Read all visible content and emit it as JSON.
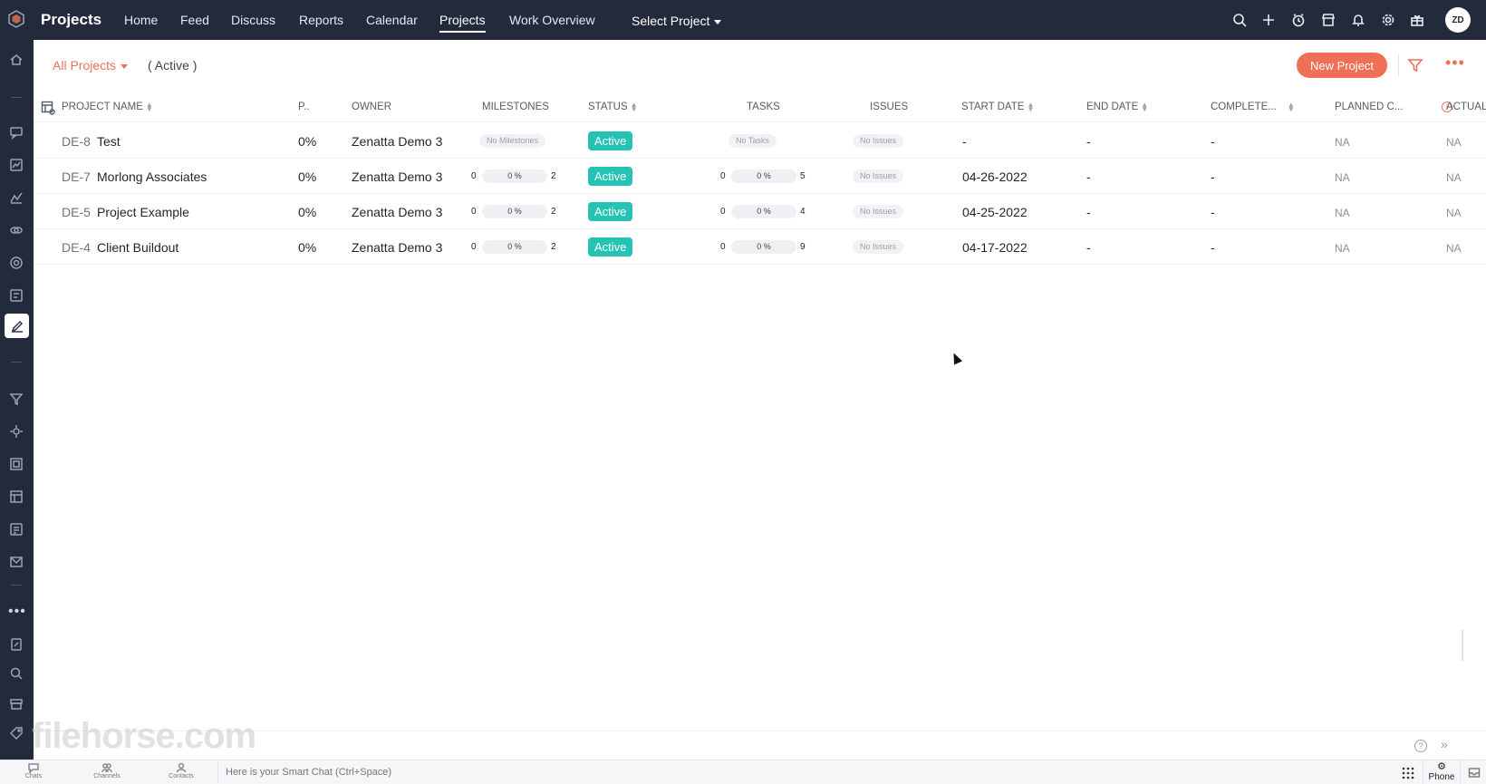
{
  "header": {
    "app_title": "Projects",
    "nav": [
      {
        "label": "Home"
      },
      {
        "label": "Feed"
      },
      {
        "label": "Discuss"
      },
      {
        "label": "Reports"
      },
      {
        "label": "Calendar"
      },
      {
        "label": "Projects",
        "active": true
      },
      {
        "label": "Work Overview"
      }
    ],
    "select_project": "Select Project",
    "icons": [
      "search-icon",
      "add-icon",
      "timer-icon",
      "store-icon",
      "bell-icon",
      "gear-icon",
      "gift-icon"
    ],
    "avatar_initials": "ZD"
  },
  "subheader": {
    "filter_label": "All Projects",
    "status_filter": "( Active )",
    "new_project_label": "New Project"
  },
  "table": {
    "columns": {
      "project_name": "PROJECT NAME",
      "percent": "P..",
      "owner": "OWNER",
      "milestones": "MILESTONES",
      "status": "STATUS",
      "tasks": "TASKS",
      "issues": "ISSUES",
      "start_date": "START DATE",
      "end_date": "END DATE",
      "completed": "COMPLETE...",
      "planned": "PLANNED C...",
      "actual": "ACTUAL"
    },
    "rows": [
      {
        "key": "DE-8",
        "name": "Test",
        "percent": "0%",
        "owner": "Zenatta Demo 3",
        "milestones_empty": "No Milestones",
        "status": "Active",
        "tasks_empty": "No Tasks",
        "issues": "No Issues",
        "start_date": "-",
        "end_date": "-",
        "completed": "-",
        "planned": "NA",
        "actual": "NA"
      },
      {
        "key": "DE-7",
        "name": "Morlong Associates",
        "percent": "0%",
        "owner": "Zenatta Demo 3",
        "milestones": {
          "done": "0",
          "pct": "0 %",
          "total": "2"
        },
        "status": "Active",
        "tasks": {
          "done": "0",
          "pct": "0 %",
          "total": "5"
        },
        "issues": "No Issues",
        "start_date": "04-26-2022",
        "end_date": "-",
        "completed": "-",
        "planned": "NA",
        "actual": "NA"
      },
      {
        "key": "DE-5",
        "name": "Project Example",
        "percent": "0%",
        "owner": "Zenatta Demo 3",
        "milestones": {
          "done": "0",
          "pct": "0 %",
          "total": "2"
        },
        "status": "Active",
        "tasks": {
          "done": "0",
          "pct": "0 %",
          "total": "4"
        },
        "issues": "No Issues",
        "start_date": "04-25-2022",
        "end_date": "-",
        "completed": "-",
        "planned": "NA",
        "actual": "NA"
      },
      {
        "key": "DE-4",
        "name": "Client Buildout",
        "percent": "0%",
        "owner": "Zenatta Demo 3",
        "milestones": {
          "done": "0",
          "pct": "0 %",
          "total": "2"
        },
        "status": "Active",
        "tasks": {
          "done": "0",
          "pct": "0 %",
          "total": "9"
        },
        "issues": "No Issues",
        "start_date": "04-17-2022",
        "end_date": "-",
        "completed": "-",
        "planned": "NA",
        "actual": "NA"
      }
    ]
  },
  "bottombar": {
    "chats": "Chats",
    "channels": "Channels",
    "contacts": "Contacts",
    "smart_chat_placeholder": "Here is your Smart Chat (Ctrl+Space)",
    "phone": "Phone"
  },
  "watermark": "filehorse.com",
  "colors": {
    "accent": "#ef6f57",
    "status_active": "#25c3b4",
    "topbar": "#232a3b"
  }
}
